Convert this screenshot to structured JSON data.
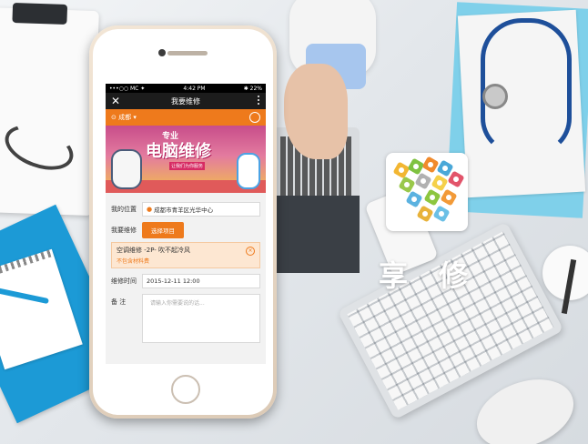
{
  "status": {
    "carrier": "•••○○ MC ✦",
    "time": "4:42 PM",
    "battery": "✱ 22%"
  },
  "nav": {
    "close_icon": "close-icon",
    "title": "我要维修",
    "more_icon": "more-icon"
  },
  "city": {
    "name": "成都",
    "chevron": "▾",
    "location_icon": "location-pin-icon",
    "user_icon": "user-icon"
  },
  "banner": {
    "top_text": "专业",
    "main_text": "电脑维修",
    "badge_text": "让我们为你服务"
  },
  "form": {
    "location_label": "我的位置",
    "location_value": "成都市青羊区光华中心",
    "repair_label": "我要维修",
    "select_button": "选择项目",
    "service_name": "空调维修 -2P- 吹不起冷风",
    "service_note": "不包含材料费",
    "remove_icon": "⊗",
    "time_label": "维修时间",
    "time_value": "2015-12-11   12:00",
    "remark_label": "备    注",
    "remark_placeholder": "请输入你需要说的话..."
  },
  "brand": {
    "name": "享修"
  },
  "colors": {
    "accent": "#ee7a1c",
    "navbar": "#1c1c1c",
    "service_bg": "#fde7d2"
  }
}
